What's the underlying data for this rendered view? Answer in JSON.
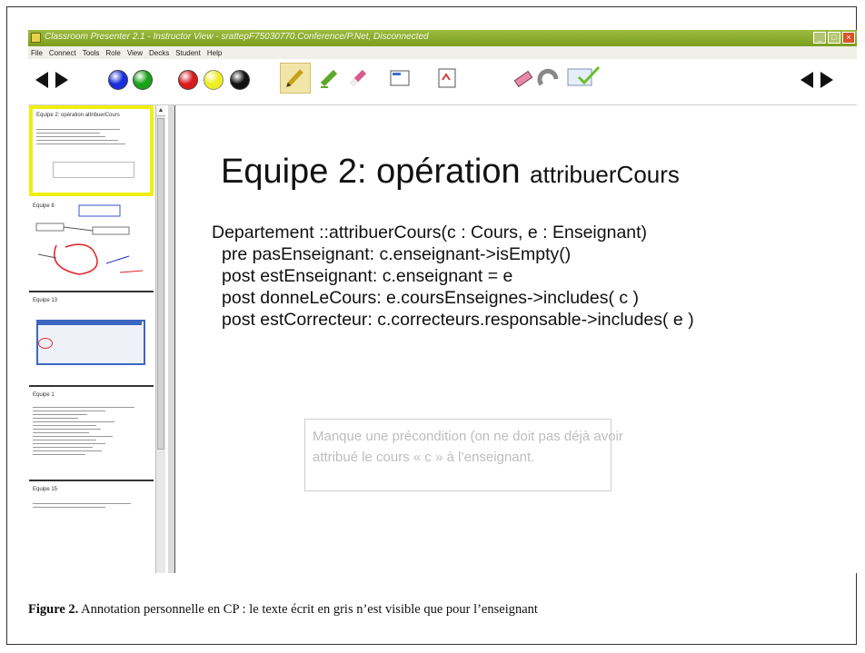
{
  "window": {
    "title": "Classroom Presenter 2.1 - Instructor View - srattepF75030770.Conference/P.Net, Disconnected",
    "minimize_label": "_",
    "maximize_label": "□",
    "close_label": "×"
  },
  "menu": {
    "items": [
      "File",
      "Connect",
      "Tools",
      "Role",
      "View",
      "Decks",
      "Student",
      "Help"
    ]
  },
  "toolbar": {
    "ink_colors": [
      "#1a2fd8",
      "#16a317",
      "#d91a1a",
      "#eeee22",
      "#111111"
    ],
    "icons": [
      "pen-icon",
      "highlighter-icon",
      "eraser-icon",
      "slide-icon",
      "whiteboard-icon",
      "clear-ink-icon",
      "undo-icon",
      "submit-icon"
    ]
  },
  "thumbnails": [
    {
      "title": "Equipe 2: opération attribuerCours"
    },
    {
      "title": "Equipe 8"
    },
    {
      "title": "Equipe 13"
    },
    {
      "title": "Equipe 1"
    },
    {
      "title": "Equipe 15"
    }
  ],
  "slide": {
    "title_main": "Equipe 2: opération ",
    "title_small": "attribuerCours",
    "lines": [
      "Departement ::attribuerCours(c : Cours, e : Enseignant)",
      "pre pasEnseignant: c.enseignant->isEmpty()",
      "post estEnseignant: c.enseignant = e",
      "post donneLeCours: e.coursEnseignes->includes( c )",
      "post estCorrecteur: c.correcteurs.responsable->includes( e )"
    ],
    "annotation": [
      "Manque une précondition (on ne doit pas déjà avoir",
      "attribué le cours « c » à l’enseignant."
    ]
  },
  "caption": {
    "label": "Figure 2.",
    "text": " Annotation personnelle en CP : le texte écrit en gris n’est visible que pour l’enseignant"
  }
}
